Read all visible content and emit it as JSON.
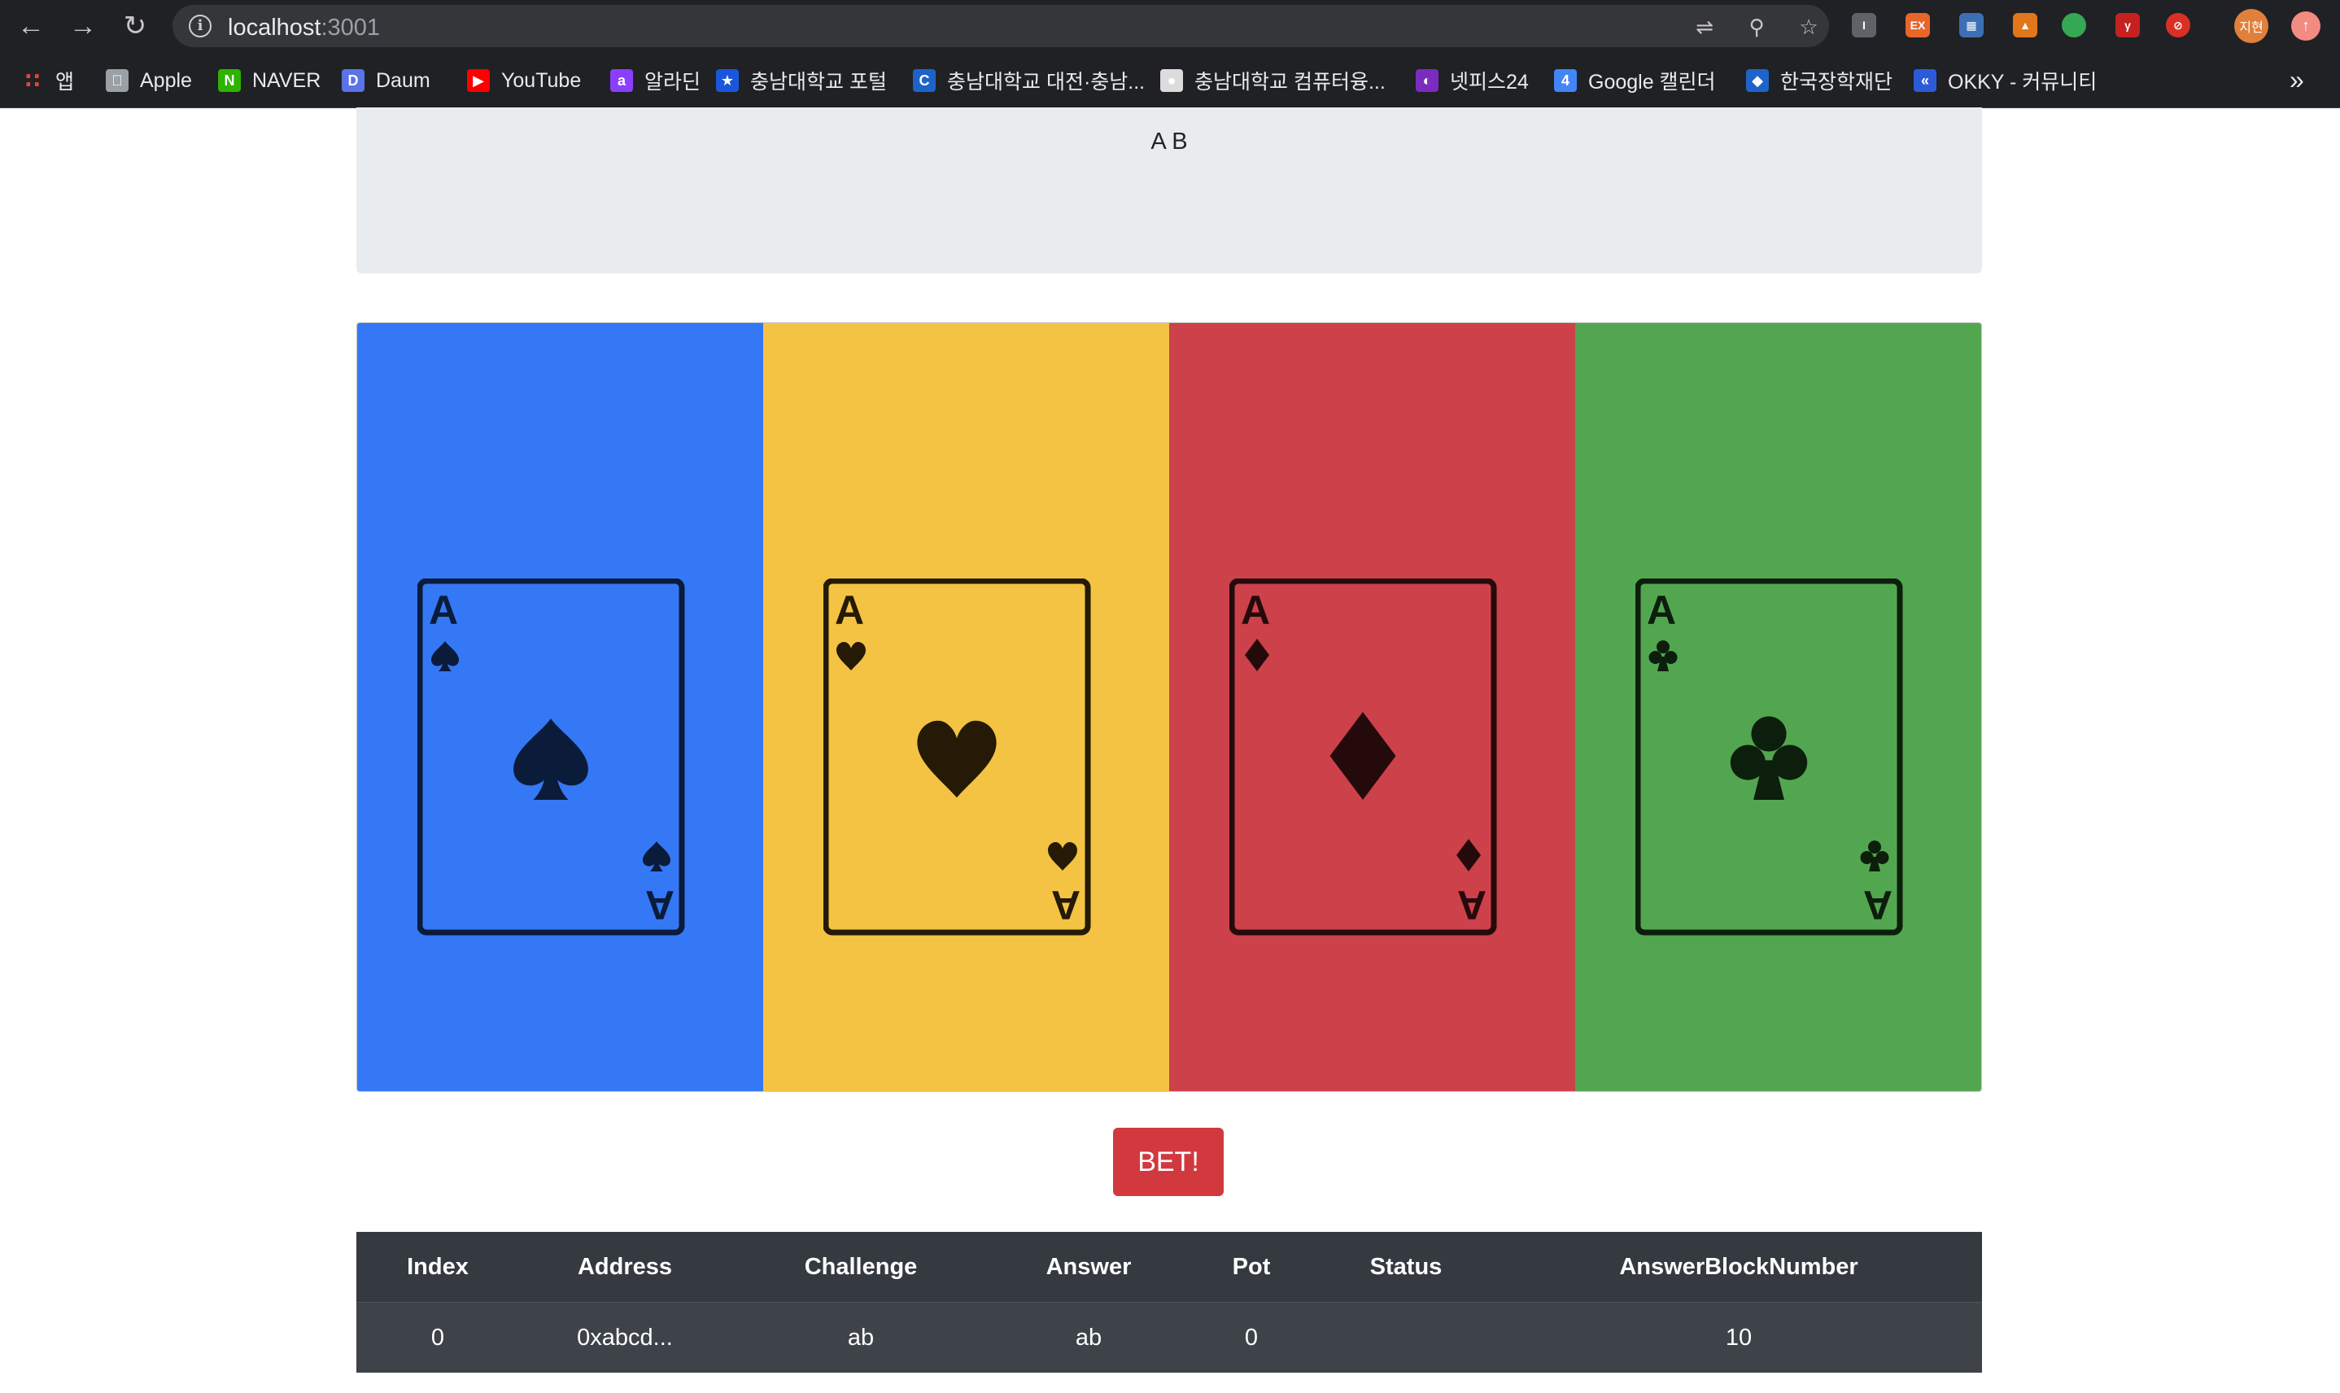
{
  "browser": {
    "url_host": "localhost",
    "url_port": ":3001",
    "bookmarks": [
      {
        "label": "앱",
        "icon": "apps-grid-icon",
        "color": "#e8eaed"
      },
      {
        "label": "Apple",
        "icon": "apple-icon",
        "color": "#9aa0a6"
      },
      {
        "label": "NAVER",
        "icon": "naver-icon",
        "color": "#2db400"
      },
      {
        "label": "Daum",
        "icon": "daum-icon",
        "color": "#5a73e8"
      },
      {
        "label": "YouTube",
        "icon": "youtube-icon",
        "color": "#ff0000"
      },
      {
        "label": "알라딘",
        "icon": "aladin-icon",
        "color": "#8a3ffc"
      },
      {
        "label": "충남대학교 포털",
        "icon": "cnu-portal-icon",
        "color": "#1a56db"
      },
      {
        "label": "충남대학교 대전·충남...",
        "icon": "cnu-icon",
        "color": "#1e64c8"
      },
      {
        "label": "충남대학교 컴퓨터융...",
        "icon": "globe-icon",
        "color": "#dcdcdc"
      },
      {
        "label": "넷피스24",
        "icon": "netffice-icon",
        "color": "#7b2cbf"
      },
      {
        "label": "Google 캘린더",
        "icon": "google-calendar-icon",
        "color": "#4285f4"
      },
      {
        "label": "한국장학재단",
        "icon": "kosaf-icon",
        "color": "#1e64c8"
      },
      {
        "label": "OKKY - 커뮤니티",
        "icon": "okky-icon",
        "color": "#2d5bd7"
      }
    ],
    "profile_initials": "지현"
  },
  "header": {
    "title": "A B"
  },
  "cards": [
    {
      "rank": "A",
      "suit": "spade",
      "color": "#3478f6",
      "symbol_color": "#0b1b3a"
    },
    {
      "rank": "A",
      "suit": "heart",
      "color": "#f4c343",
      "symbol_color": "#241a05"
    },
    {
      "rank": "A",
      "suit": "diamond",
      "color": "#cc414a",
      "symbol_color": "#250a0c"
    },
    {
      "rank": "A",
      "suit": "club",
      "color": "#53a650",
      "symbol_color": "#0c1e0c"
    }
  ],
  "bet_button": {
    "label": "BET!",
    "color": "#d1393f"
  },
  "table": {
    "headers": [
      "Index",
      "Address",
      "Challenge",
      "Answer",
      "Pot",
      "Status",
      "AnswerBlockNumber"
    ],
    "rows": [
      [
        "0",
        "0xabcd...",
        "ab",
        "ab",
        "0",
        "",
        "10"
      ]
    ]
  }
}
